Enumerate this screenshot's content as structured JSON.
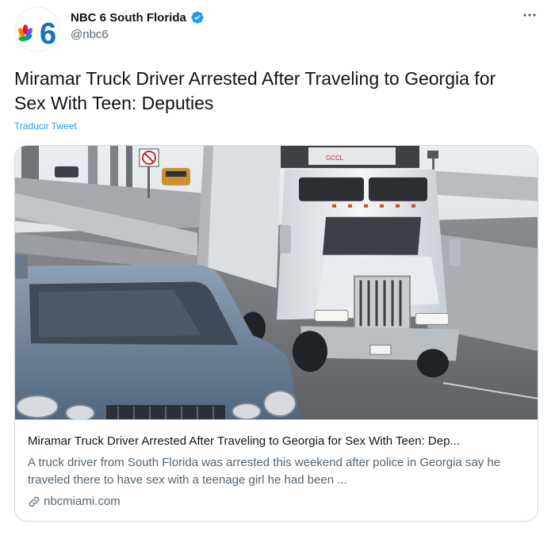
{
  "author": {
    "name": "NBC 6 South Florida",
    "handle": "@nbc6",
    "logo_text": "6"
  },
  "tweet": {
    "text": "Miramar Truck Driver Arrested After Traveling to Georgia for Sex With Teen: Deputies",
    "translate_label": "Traducir Tweet"
  },
  "card": {
    "title": "Miramar Truck Driver Arrested After Traveling to Georgia for Sex With Teen: Dep...",
    "description": "A truck driver from South Florida was arrested this weekend after police in Georgia say he traveled there to have sex with a teenage girl he had been ...",
    "domain": "nbcmiami.com",
    "image_alt": "White semi truck driving on highway behind a silver car"
  },
  "colors": {
    "accent": "#1d9bf0",
    "text": "#0f1419",
    "secondary": "#536471",
    "border": "#cfd9de"
  },
  "icons": {
    "verified": "verified-badge-icon",
    "more": "more-options-icon",
    "link": "link-icon"
  }
}
